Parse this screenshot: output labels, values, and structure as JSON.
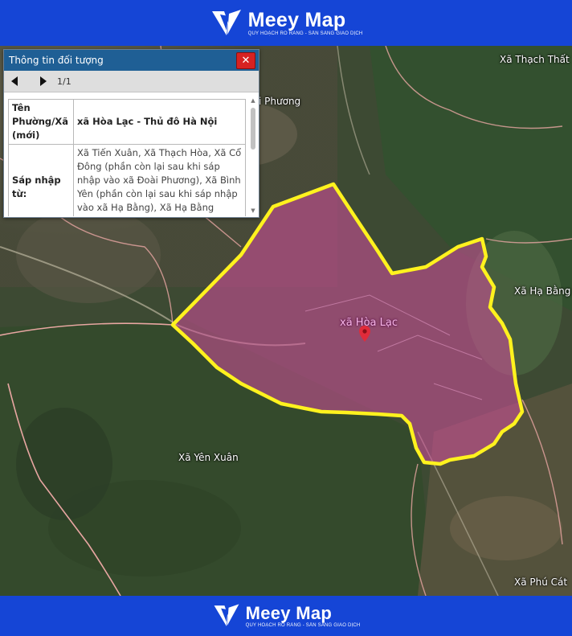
{
  "brand": {
    "name": "Meey Map",
    "tagline": "QUY HOẠCH RÕ RÀNG - SẴN SÀNG GIAO DỊCH"
  },
  "colors": {
    "brand_blue": "#1545d6",
    "boundary": "#fff21e",
    "highlight_fill": "#d64f9e",
    "panel_header": "#1f5f95",
    "close_red": "#d72222"
  },
  "info_panel": {
    "title": "Thông tin đối tượng",
    "close_icon": "close-icon",
    "prev_icon": "triangle-left-icon",
    "next_icon": "triangle-right-icon",
    "page_indicator": "1/1",
    "rows": [
      {
        "label": "Tên Phường/Xã (mới)",
        "value": "xã Hòa Lạc - Thủ đô Hà Nội"
      },
      {
        "label": "Sáp nhập từ:",
        "value": "Xã Tiến Xuân, Xã Thạch Hòa, Xã Cổ Đông (phần còn lại sau khi sáp nhập vào xã Đoài Phương), Xã Bình Yên (phần còn lại sau khi sáp nhập vào xã Hạ Bằng), Xã Hạ Bằng (phần còn lại"
      }
    ]
  },
  "map": {
    "selected_area": "xã Hòa Lạc",
    "marker_icon": "map-pin-icon",
    "places": {
      "thach_that": "Xã Thạch Thất",
      "doai_phuong": "i Phương",
      "ha_bang": "Xã Hạ Bằng",
      "yen_xuan": "Xã Yên Xuân",
      "phu_cat": "Xã Phú Cát"
    }
  }
}
